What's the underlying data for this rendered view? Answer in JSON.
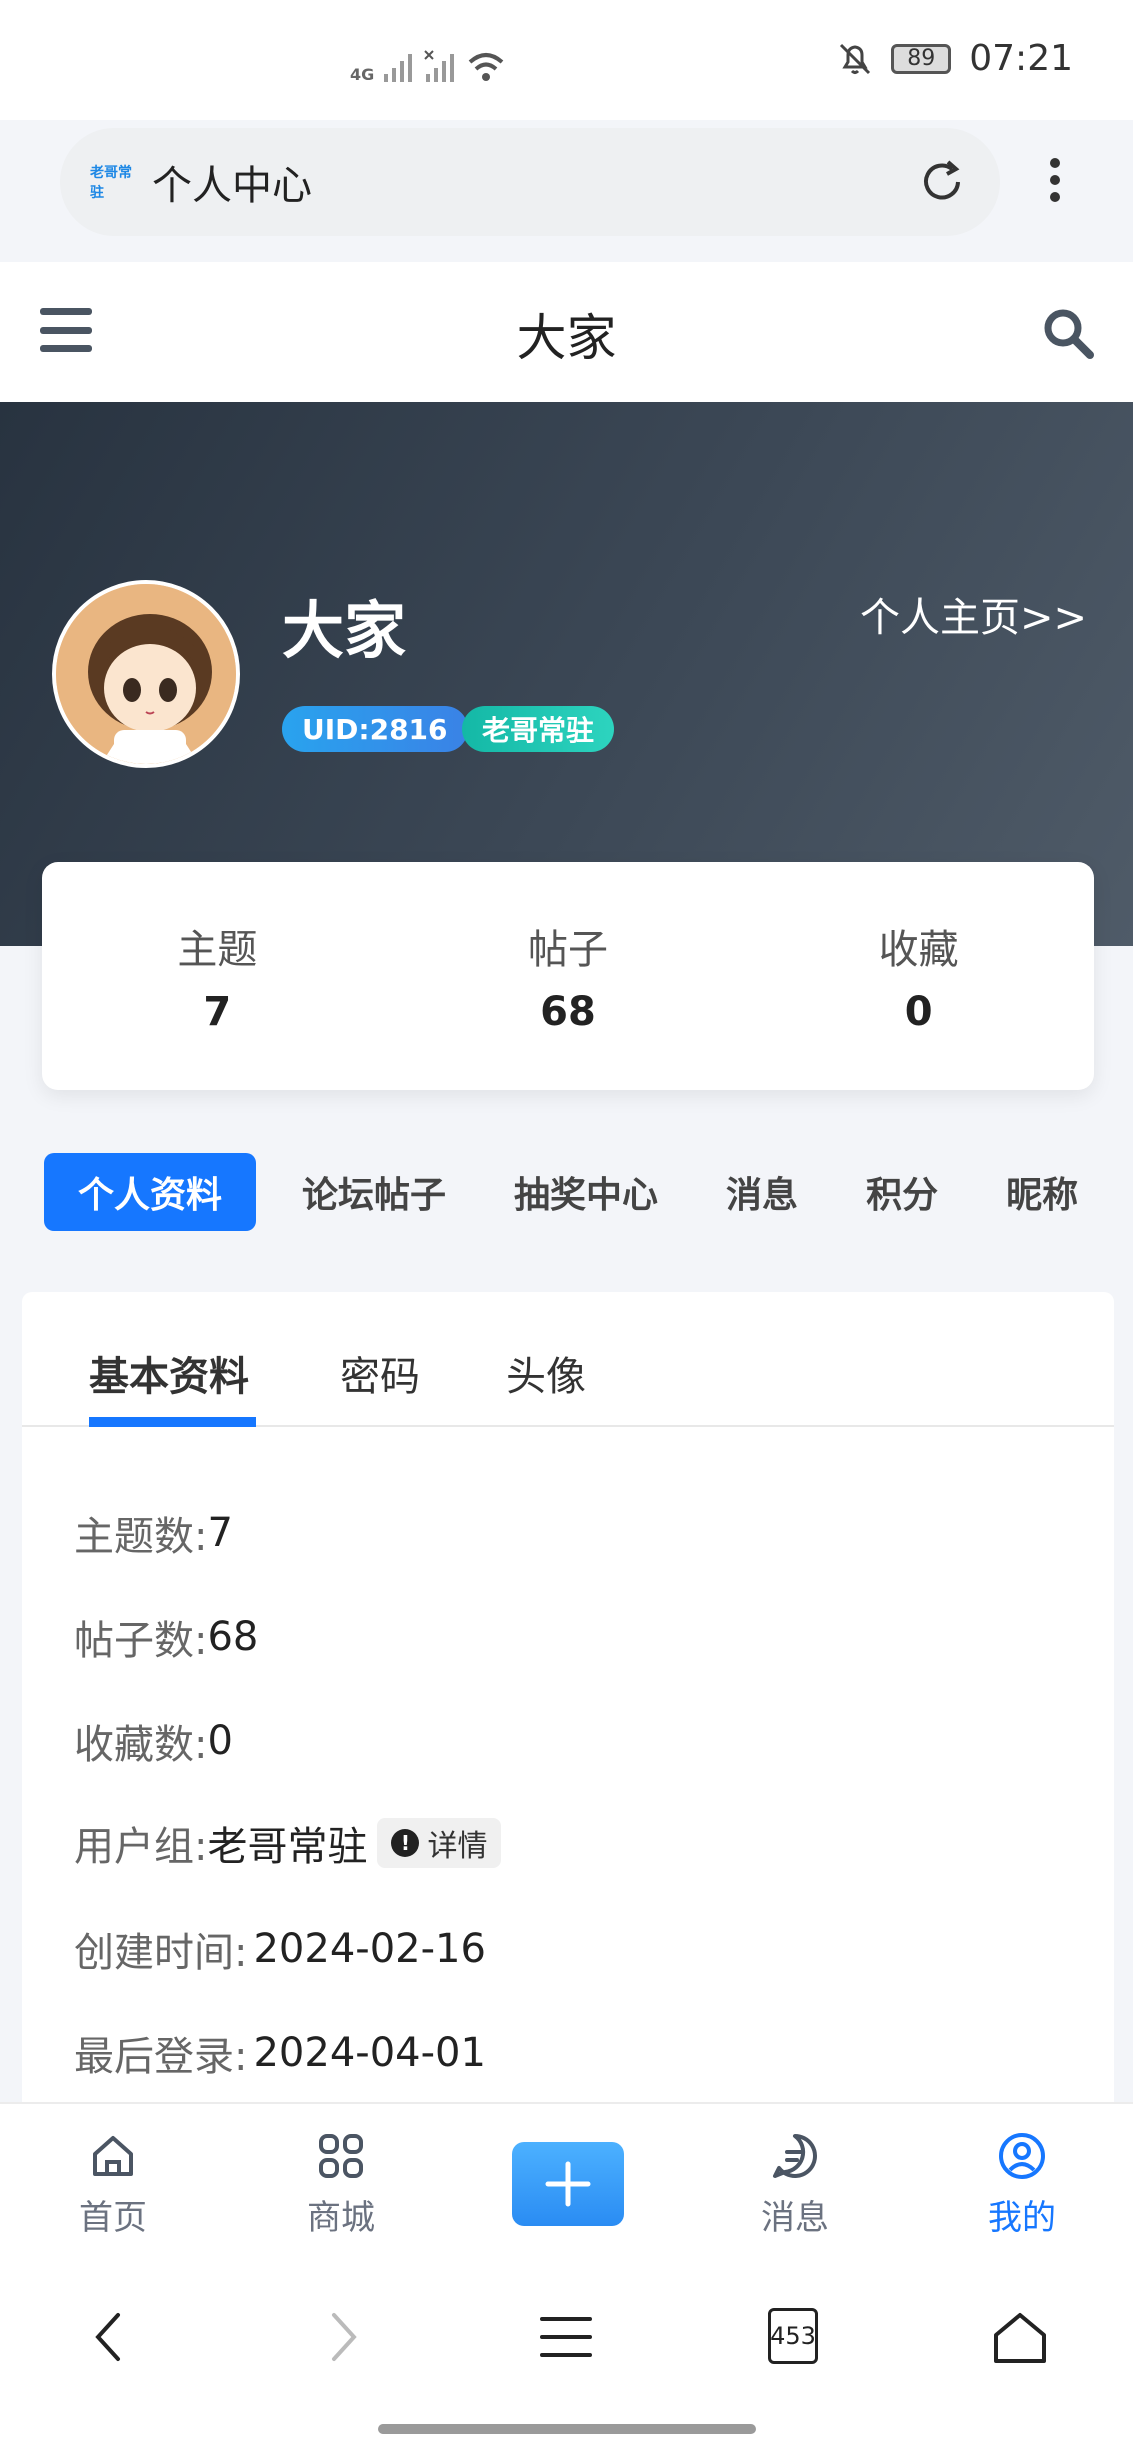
{
  "status_bar": {
    "network_label": "4G",
    "battery": "89",
    "time": "07:21"
  },
  "browser": {
    "site_logo_text": "老哥常驻",
    "page_title": "个人中心",
    "tab_count": "453"
  },
  "header": {
    "site_title": "大家"
  },
  "profile": {
    "name": "大家",
    "home_link": "个人主页>>",
    "uid_badge": "UID:2816",
    "group_badge": "老哥常驻"
  },
  "stats": [
    {
      "label": "主题",
      "value": "7"
    },
    {
      "label": "帖子",
      "value": "68"
    },
    {
      "label": "收藏",
      "value": "0"
    }
  ],
  "tabs": [
    "个人资料",
    "论坛帖子",
    "抽奖中心",
    "消息",
    "积分",
    "昵称"
  ],
  "subtabs": [
    "基本资料",
    "密码",
    "头像"
  ],
  "info": {
    "topics_key": "主题数:",
    "topics_val": "7",
    "posts_key": "帖子数:",
    "posts_val": "68",
    "fav_key": "收藏数:",
    "fav_val": "0",
    "group_key": "用户组:",
    "group_val": "老哥常驻",
    "detail_label": "详情",
    "created_key": "创建时间:",
    "created_val": "2024-02-16",
    "login_key": "最后登录:",
    "login_val": "2024-04-01"
  },
  "bottom_nav": [
    "首页",
    "商城",
    "消息",
    "我的"
  ],
  "colors": {
    "accent": "#1677ff",
    "banner": "#2f3a47"
  }
}
